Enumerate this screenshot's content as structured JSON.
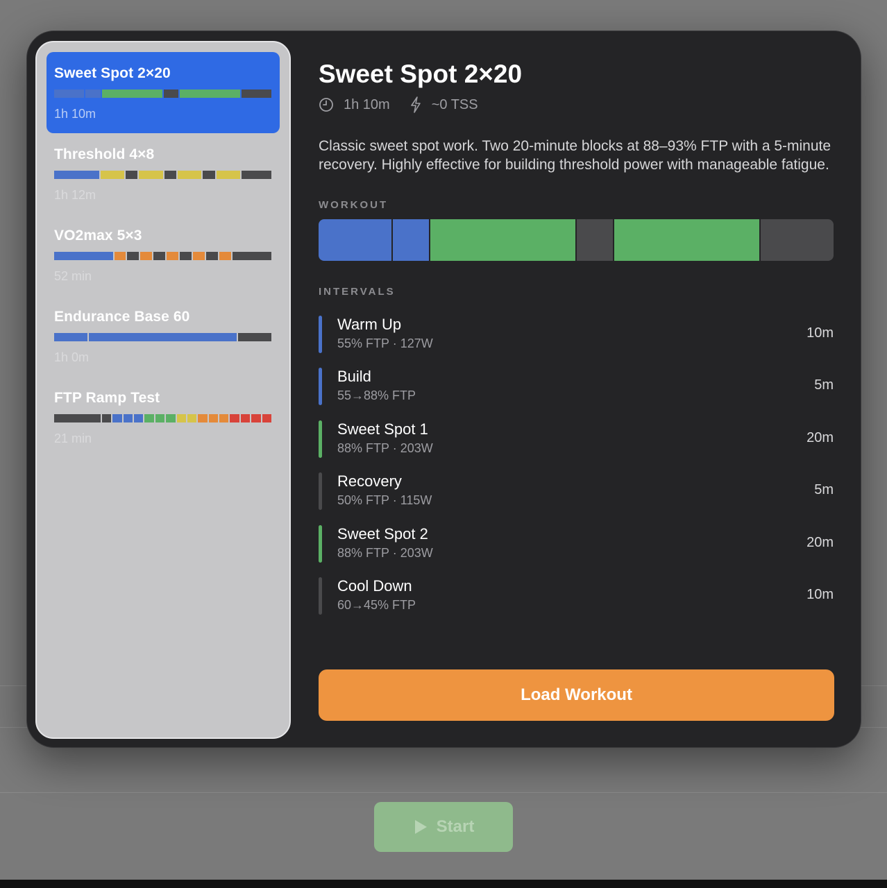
{
  "colors": {
    "blue": "#4a72c9",
    "green": "#5bb065",
    "dark": "#4a4a4c",
    "yellow": "#d6c44a",
    "orange": "#e48a3a",
    "red": "#d8433a",
    "accent": "#ee9440"
  },
  "sidebar": {
    "workouts": [
      {
        "name": "Sweet Spot 2×20",
        "duration": "1h 10m",
        "selected": true,
        "segments": [
          {
            "zone": "blue",
            "w": 10
          },
          {
            "zone": "blue",
            "w": 5
          },
          {
            "zone": "green",
            "w": 20
          },
          {
            "zone": "dark",
            "w": 5
          },
          {
            "zone": "green",
            "w": 20
          },
          {
            "zone": "dark",
            "w": 10
          }
        ]
      },
      {
        "name": "Threshold 4×8",
        "duration": "1h 12m",
        "selected": false,
        "segments": [
          {
            "zone": "blue",
            "w": 15
          },
          {
            "zone": "yellow",
            "w": 8
          },
          {
            "zone": "dark",
            "w": 4
          },
          {
            "zone": "yellow",
            "w": 8
          },
          {
            "zone": "dark",
            "w": 4
          },
          {
            "zone": "yellow",
            "w": 8
          },
          {
            "zone": "dark",
            "w": 4
          },
          {
            "zone": "yellow",
            "w": 8
          },
          {
            "zone": "dark",
            "w": 10
          }
        ]
      },
      {
        "name": "VO2max 5×3",
        "duration": "52 min",
        "selected": false,
        "segments": [
          {
            "zone": "blue",
            "w": 15
          },
          {
            "zone": "orange",
            "w": 3
          },
          {
            "zone": "dark",
            "w": 3
          },
          {
            "zone": "orange",
            "w": 3
          },
          {
            "zone": "dark",
            "w": 3
          },
          {
            "zone": "orange",
            "w": 3
          },
          {
            "zone": "dark",
            "w": 3
          },
          {
            "zone": "orange",
            "w": 3
          },
          {
            "zone": "dark",
            "w": 3
          },
          {
            "zone": "orange",
            "w": 3
          },
          {
            "zone": "dark",
            "w": 10
          }
        ]
      },
      {
        "name": "Endurance Base 60",
        "duration": "1h 0m",
        "selected": false,
        "segments": [
          {
            "zone": "blue",
            "w": 8
          },
          {
            "zone": "blue",
            "w": 35
          },
          {
            "zone": "dark",
            "w": 8
          }
        ]
      },
      {
        "name": "FTP Ramp Test",
        "duration": "21 min",
        "selected": false,
        "segments": [
          {
            "zone": "dark",
            "w": 5
          },
          {
            "zone": "dark",
            "w": 1
          },
          {
            "zone": "blue",
            "w": 1
          },
          {
            "zone": "blue",
            "w": 1
          },
          {
            "zone": "blue",
            "w": 1
          },
          {
            "zone": "green",
            "w": 1
          },
          {
            "zone": "green",
            "w": 1
          },
          {
            "zone": "green",
            "w": 1
          },
          {
            "zone": "yellow",
            "w": 1
          },
          {
            "zone": "yellow",
            "w": 1
          },
          {
            "zone": "orange",
            "w": 1
          },
          {
            "zone": "orange",
            "w": 1
          },
          {
            "zone": "orange",
            "w": 1
          },
          {
            "zone": "red",
            "w": 1
          },
          {
            "zone": "red",
            "w": 1
          },
          {
            "zone": "red",
            "w": 1
          },
          {
            "zone": "red",
            "w": 1
          }
        ]
      }
    ]
  },
  "detail": {
    "title": "Sweet Spot 2×20",
    "duration": "1h 10m",
    "tss": "~0 TSS",
    "description": "Classic sweet spot work. Two 20-minute blocks at 88–93% FTP with a 5-minute recovery. Highly effective for building threshold power with manageable fatigue.",
    "workout_label": "WORKOUT",
    "intervals_label": "INTERVALS",
    "workout_blocks": [
      {
        "zone": "blue",
        "w": 10
      },
      {
        "zone": "blue",
        "w": 5
      },
      {
        "zone": "green",
        "w": 20
      },
      {
        "zone": "dark",
        "w": 5
      },
      {
        "zone": "green",
        "w": 20
      },
      {
        "zone": "dark",
        "w": 10
      }
    ],
    "intervals": [
      {
        "name": "Warm Up",
        "detail": "55% FTP · 127W",
        "duration": "10m",
        "zone": "blue"
      },
      {
        "name": "Build",
        "detail": "55→88% FTP",
        "duration": "5m",
        "zone": "blue"
      },
      {
        "name": "Sweet Spot 1",
        "detail": "88% FTP · 203W",
        "duration": "20m",
        "zone": "green"
      },
      {
        "name": "Recovery",
        "detail": "50% FTP · 115W",
        "duration": "5m",
        "zone": "dark"
      },
      {
        "name": "Sweet Spot 2",
        "detail": "88% FTP · 203W",
        "duration": "20m",
        "zone": "green"
      },
      {
        "name": "Cool Down",
        "detail": "60→45% FTP",
        "duration": "10m",
        "zone": "dark"
      }
    ]
  },
  "actions": {
    "load_label": "Load Workout",
    "start_label": "Start"
  },
  "icons": {
    "clock": "clock-icon",
    "bolt": "bolt-icon",
    "play": "play-icon"
  }
}
